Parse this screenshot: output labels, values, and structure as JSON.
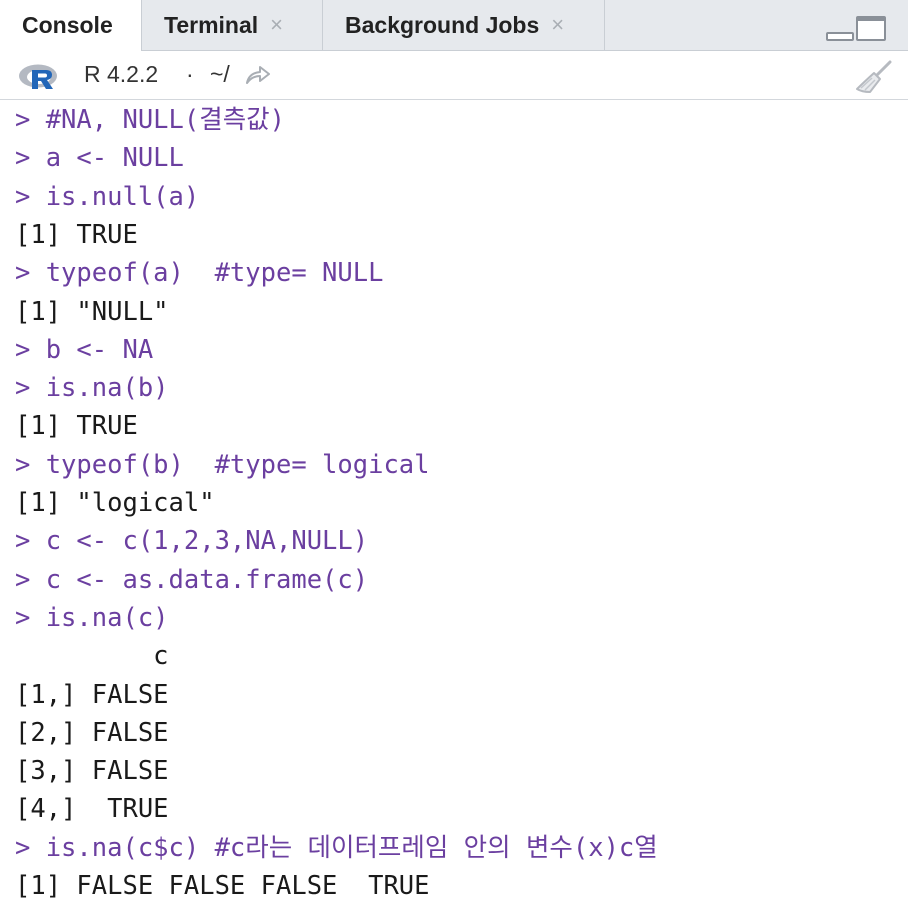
{
  "tabs": [
    {
      "label": "Console",
      "active": true
    },
    {
      "label": "Terminal",
      "close": "×"
    },
    {
      "label": "Background Jobs",
      "close": "×"
    }
  ],
  "toolbar": {
    "r_version": "R 4.2.2",
    "separator": "·",
    "working_dir": "~/"
  },
  "colors": {
    "command": "#6b3fa0",
    "output": "#1a1a1a",
    "tab_bg": "#e6e9ed"
  },
  "console_lines": [
    {
      "type": "cmd",
      "text": "> #NA, NULL(결측값)"
    },
    {
      "type": "cmd",
      "text": "> a <- NULL"
    },
    {
      "type": "cmd",
      "text": "> is.null(a)"
    },
    {
      "type": "out",
      "text": "[1] TRUE"
    },
    {
      "type": "cmd",
      "text": "> typeof(a)  #type= NULL"
    },
    {
      "type": "out",
      "text": "[1] \"NULL\""
    },
    {
      "type": "cmd",
      "text": "> b <- NA"
    },
    {
      "type": "cmd",
      "text": "> is.na(b)"
    },
    {
      "type": "out",
      "text": "[1] TRUE"
    },
    {
      "type": "cmd",
      "text": "> typeof(b)  #type= logical"
    },
    {
      "type": "out",
      "text": "[1] \"logical\""
    },
    {
      "type": "cmd",
      "text": "> c <- c(1,2,3,NA,NULL)"
    },
    {
      "type": "cmd",
      "text": "> c <- as.data.frame(c)"
    },
    {
      "type": "cmd",
      "text": "> is.na(c)"
    },
    {
      "type": "out",
      "text": "         c"
    },
    {
      "type": "out",
      "text": "[1,] FALSE"
    },
    {
      "type": "out",
      "text": "[2,] FALSE"
    },
    {
      "type": "out",
      "text": "[3,] FALSE"
    },
    {
      "type": "out",
      "text": "[4,]  TRUE"
    },
    {
      "type": "cmd",
      "text": "> is.na(c$c) #c라는 데이터프레임 안의 변수(x)c열"
    },
    {
      "type": "out",
      "text": "[1] FALSE FALSE FALSE  TRUE"
    }
  ]
}
